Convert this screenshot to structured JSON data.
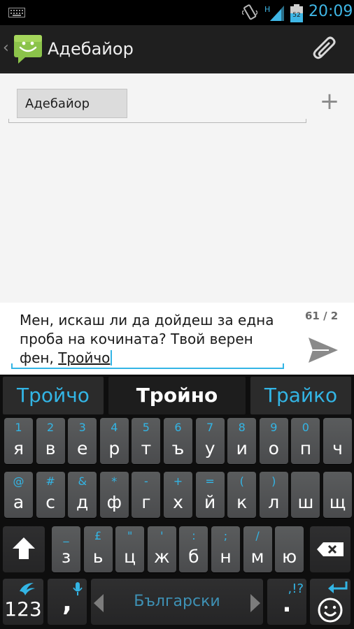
{
  "status_bar": {
    "time": "20:09",
    "battery_level": "52",
    "network_type": "H",
    "icons": [
      "keyboard-icon",
      "vibrate-icon",
      "signal-icon",
      "battery-icon"
    ],
    "accent": "#3fb6e5"
  },
  "action_bar": {
    "title": "Адебайор",
    "back_glyph": "‹",
    "icons": [
      "messaging-app-icon",
      "attach-icon"
    ]
  },
  "recipients": {
    "chips": [
      "Адебайор"
    ],
    "add_glyph": "+"
  },
  "compose": {
    "text_before": "Мен, искаш ли да дойдеш за една проба на кочината? Твой верен фен, ",
    "composing_word": "Тройчо",
    "counter": "61 / 2"
  },
  "keyboard": {
    "suggestions": [
      "Тройчо",
      "Тройно",
      "Трайко"
    ],
    "rows": [
      [
        {
          "p": "я",
          "s": "1"
        },
        {
          "p": "в",
          "s": "2"
        },
        {
          "p": "е",
          "s": "3"
        },
        {
          "p": "р",
          "s": "4"
        },
        {
          "p": "т",
          "s": "5"
        },
        {
          "p": "ъ",
          "s": "6"
        },
        {
          "p": "у",
          "s": "7"
        },
        {
          "p": "и",
          "s": "8"
        },
        {
          "p": "о",
          "s": "9"
        },
        {
          "p": "п",
          "s": "0"
        },
        {
          "p": "ч",
          "s": ""
        }
      ],
      [
        {
          "p": "а",
          "s": "@"
        },
        {
          "p": "с",
          "s": "#"
        },
        {
          "p": "д",
          "s": "&"
        },
        {
          "p": "ф",
          "s": "*"
        },
        {
          "p": "г",
          "s": "-"
        },
        {
          "p": "х",
          "s": "+"
        },
        {
          "p": "й",
          "s": "="
        },
        {
          "p": "к",
          "s": "("
        },
        {
          "p": "л",
          "s": ")"
        },
        {
          "p": "ш",
          "s": ""
        },
        {
          "p": "щ",
          "s": ""
        }
      ],
      [
        {
          "p": "з",
          "s": "_"
        },
        {
          "p": "ь",
          "s": "£"
        },
        {
          "p": "ц",
          "s": "\""
        },
        {
          "p": "ж",
          "s": "'"
        },
        {
          "p": "б",
          "s": ":"
        },
        {
          "p": "н",
          "s": ";"
        },
        {
          "p": "м",
          "s": "/"
        },
        {
          "p": "ю",
          "s": ""
        }
      ]
    ],
    "numbers_label": "123",
    "comma": ",",
    "language": "Български",
    "period": ".",
    "period_alt": ",!?"
  }
}
